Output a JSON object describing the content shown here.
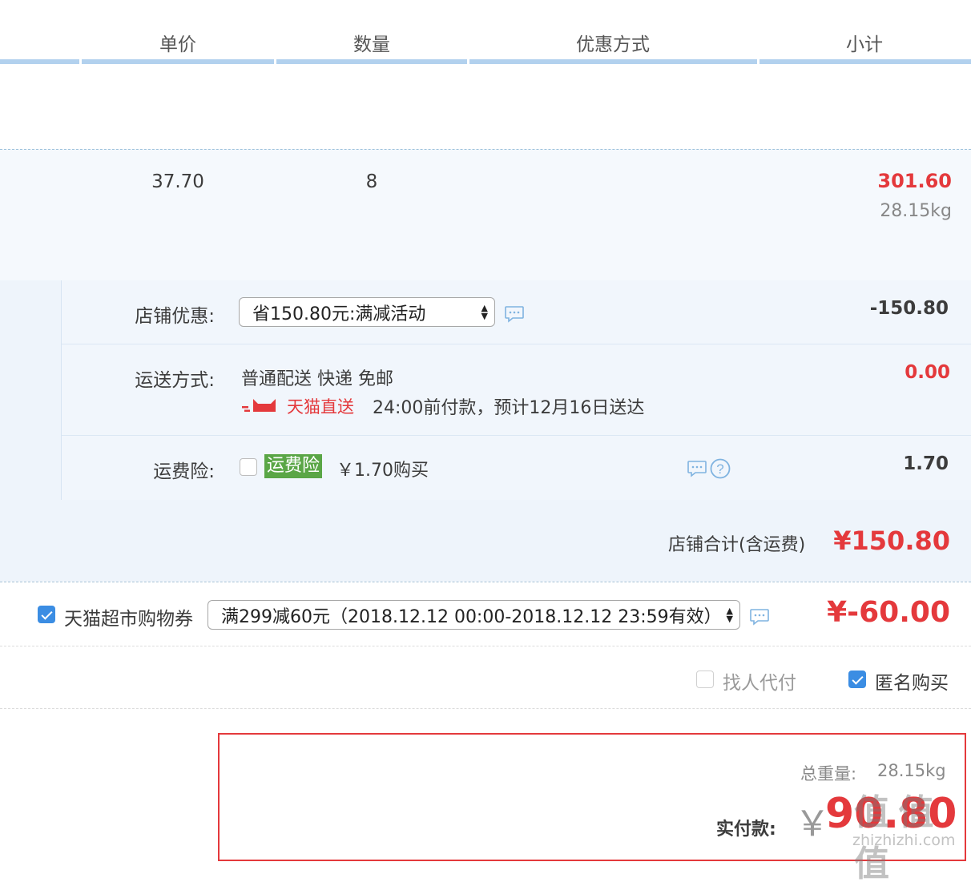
{
  "header": {
    "col_unit_price": "单价",
    "col_quantity": "数量",
    "col_discount": "优惠方式",
    "col_subtotal": "小计"
  },
  "item": {
    "unit_price": "37.70",
    "quantity": "8",
    "subtotal": "301.60",
    "weight": "28.15kg"
  },
  "shop": {
    "discount_label": "店铺优惠:",
    "discount_select": "省150.80元:满减活动",
    "discount_amount": "-150.80",
    "shipping_label": "运送方式:",
    "shipping_method": "普通配送 快递 免邮",
    "tmall_direct": "天猫直送",
    "delivery_note": "24:00前付款，预计12月16日送达",
    "shipping_amount": "0.00",
    "insurance_label": "运费险:",
    "insurance_badge": "运费险",
    "insurance_price": "￥1.70购买",
    "insurance_amount": "1.70",
    "total_label": "店铺合计(含运费)",
    "total_amount": "¥150.80"
  },
  "coupon": {
    "label": "天猫超市购物券",
    "select": "满299减60元（2018.12.12 00:00-2018.12.12 23:59有效）",
    "amount": "¥-60.00",
    "checked": true
  },
  "options": {
    "find_payer": "找人代付",
    "anonymous": "匿名购买"
  },
  "summary": {
    "weight_label": "总重量:",
    "weight_value": "28.15kg",
    "pay_label": "实付款:",
    "currency": "￥",
    "pay_amount": "90.80"
  },
  "watermark": {
    "logo": "值 值 值",
    "site": "zhizhizhi.com"
  },
  "colors": {
    "accent_red": "#e4393c",
    "header_bar": "#b2d1ee",
    "checkbox_blue": "#3b8de3",
    "insurance_green": "#5aa646"
  }
}
